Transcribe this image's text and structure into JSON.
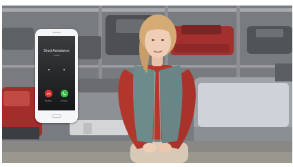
{
  "phone": {
    "caller_name": "Drust Assistance",
    "caller_sub": "mobile",
    "decline_label": "Decline",
    "accept_label": "Accept"
  },
  "icons": [
    "phone-decline-icon",
    "phone-accept-icon"
  ],
  "colors": {
    "decline": "#e0362f",
    "accept": "#3bbf4a",
    "sweater": "#b1362c",
    "vest": "#6e8b8c",
    "hair": "#d4aa75"
  }
}
